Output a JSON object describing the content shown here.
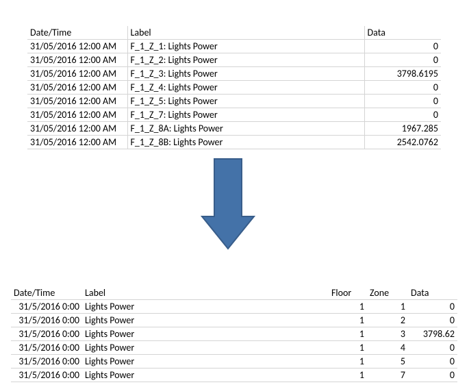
{
  "table1": {
    "headers": {
      "datetime": "Date/Time",
      "label": "Label",
      "data": "Data"
    },
    "rows": [
      {
        "datetime": "31/05/2016 12:00 AM",
        "label": "F_1_Z_1: Lights Power",
        "data": "0"
      },
      {
        "datetime": "31/05/2016 12:00 AM",
        "label": "F_1_Z_2: Lights Power",
        "data": "0"
      },
      {
        "datetime": "31/05/2016 12:00 AM",
        "label": "F_1_Z_3: Lights Power",
        "data": "3798.6195"
      },
      {
        "datetime": "31/05/2016 12:00 AM",
        "label": "F_1_Z_4: Lights Power",
        "data": "0"
      },
      {
        "datetime": "31/05/2016 12:00 AM",
        "label": "F_1_Z_5: Lights Power",
        "data": "0"
      },
      {
        "datetime": "31/05/2016 12:00 AM",
        "label": "F_1_Z_7: Lights Power",
        "data": "0"
      },
      {
        "datetime": "31/05/2016 12:00 AM",
        "label": "F_1_Z_8A: Lights Power",
        "data": "1967.285"
      },
      {
        "datetime": "31/05/2016 12:00 AM",
        "label": "F_1_Z_8B: Lights Power",
        "data": "2542.0762"
      }
    ]
  },
  "table2": {
    "headers": {
      "datetime": "Date/Time",
      "label": "Label",
      "floor": "Floor",
      "zone": "Zone",
      "data": "Data"
    },
    "rows": [
      {
        "datetime": "31/5/2016 0:00",
        "label": "Lights Power",
        "floor": "1",
        "zone": "1",
        "data": "0"
      },
      {
        "datetime": "31/5/2016 0:00",
        "label": "Lights Power",
        "floor": "1",
        "zone": "2",
        "data": "0"
      },
      {
        "datetime": "31/5/2016 0:00",
        "label": "Lights Power",
        "floor": "1",
        "zone": "3",
        "data": "3798.62"
      },
      {
        "datetime": "31/5/2016 0:00",
        "label": "Lights Power",
        "floor": "1",
        "zone": "4",
        "data": "0"
      },
      {
        "datetime": "31/5/2016 0:00",
        "label": "Lights Power",
        "floor": "1",
        "zone": "5",
        "data": "0"
      },
      {
        "datetime": "31/5/2016 0:00",
        "label": "Lights Power",
        "floor": "1",
        "zone": "7",
        "data": "0"
      }
    ]
  },
  "arrow": {
    "fill": "#4472A8",
    "stroke": "#385D8A"
  }
}
